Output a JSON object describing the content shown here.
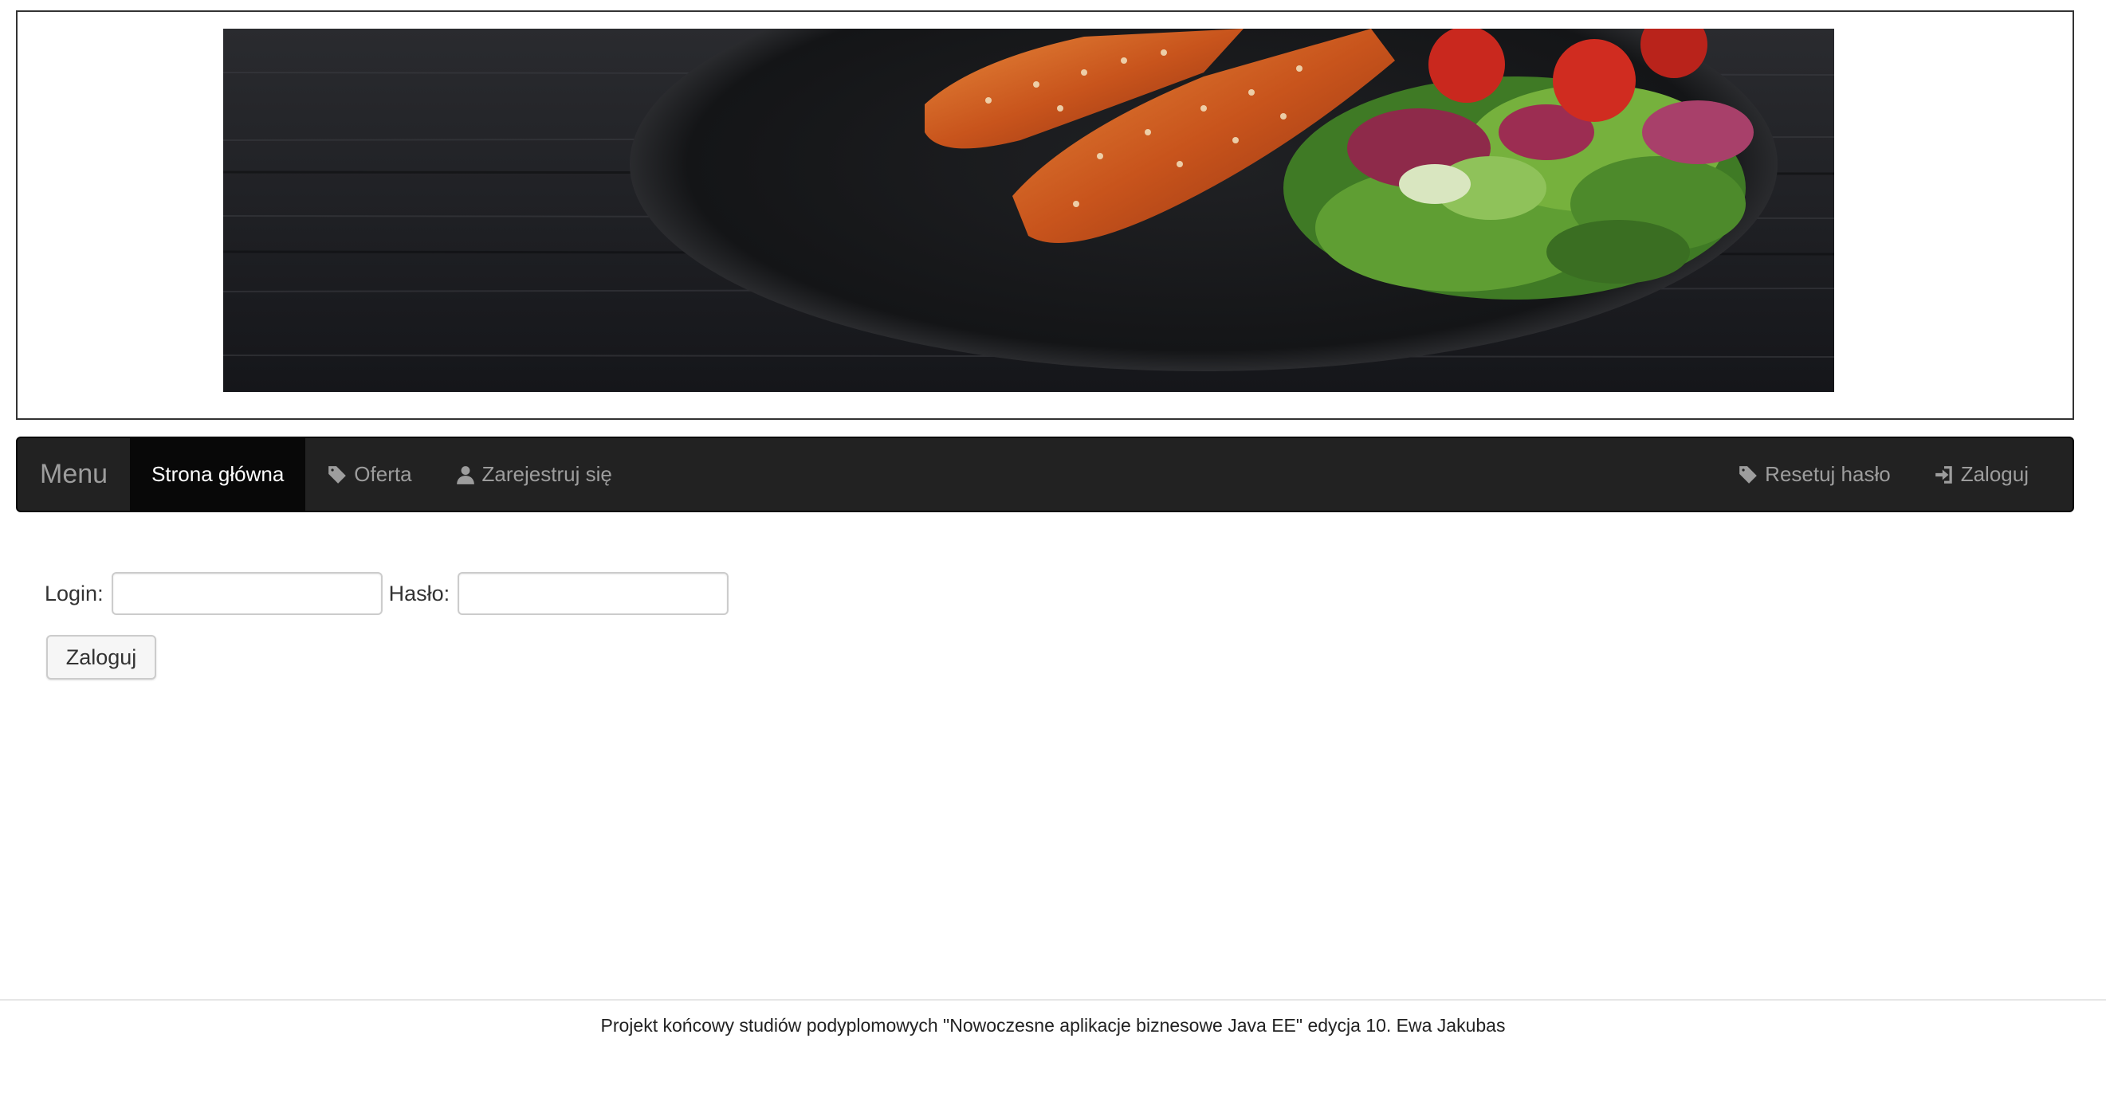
{
  "navbar": {
    "brand": "Menu",
    "items": [
      {
        "label": "Strona główna",
        "icon": ""
      },
      {
        "label": "Oferta",
        "icon": "tag-icon"
      },
      {
        "label": "Zarejestruj się",
        "icon": "user-icon"
      }
    ],
    "right_items": [
      {
        "label": "Resetuj hasło",
        "icon": "tag-icon"
      },
      {
        "label": "Zaloguj",
        "icon": "log-in-icon"
      }
    ]
  },
  "login_form": {
    "login_label": "Login:",
    "login_value": "",
    "password_label": "Hasło:",
    "password_value": "",
    "submit_label": "Zaloguj"
  },
  "footer": {
    "text": "Projekt końcowy studiów podyplomowych \"Nowoczesne aplikacje biznesowe Java EE\" edycja 10. Ewa Jakubas"
  },
  "colors": {
    "navbar_bg": "#222222",
    "navbar_active_bg": "#080808",
    "navbar_text": "#9d9d9d"
  }
}
